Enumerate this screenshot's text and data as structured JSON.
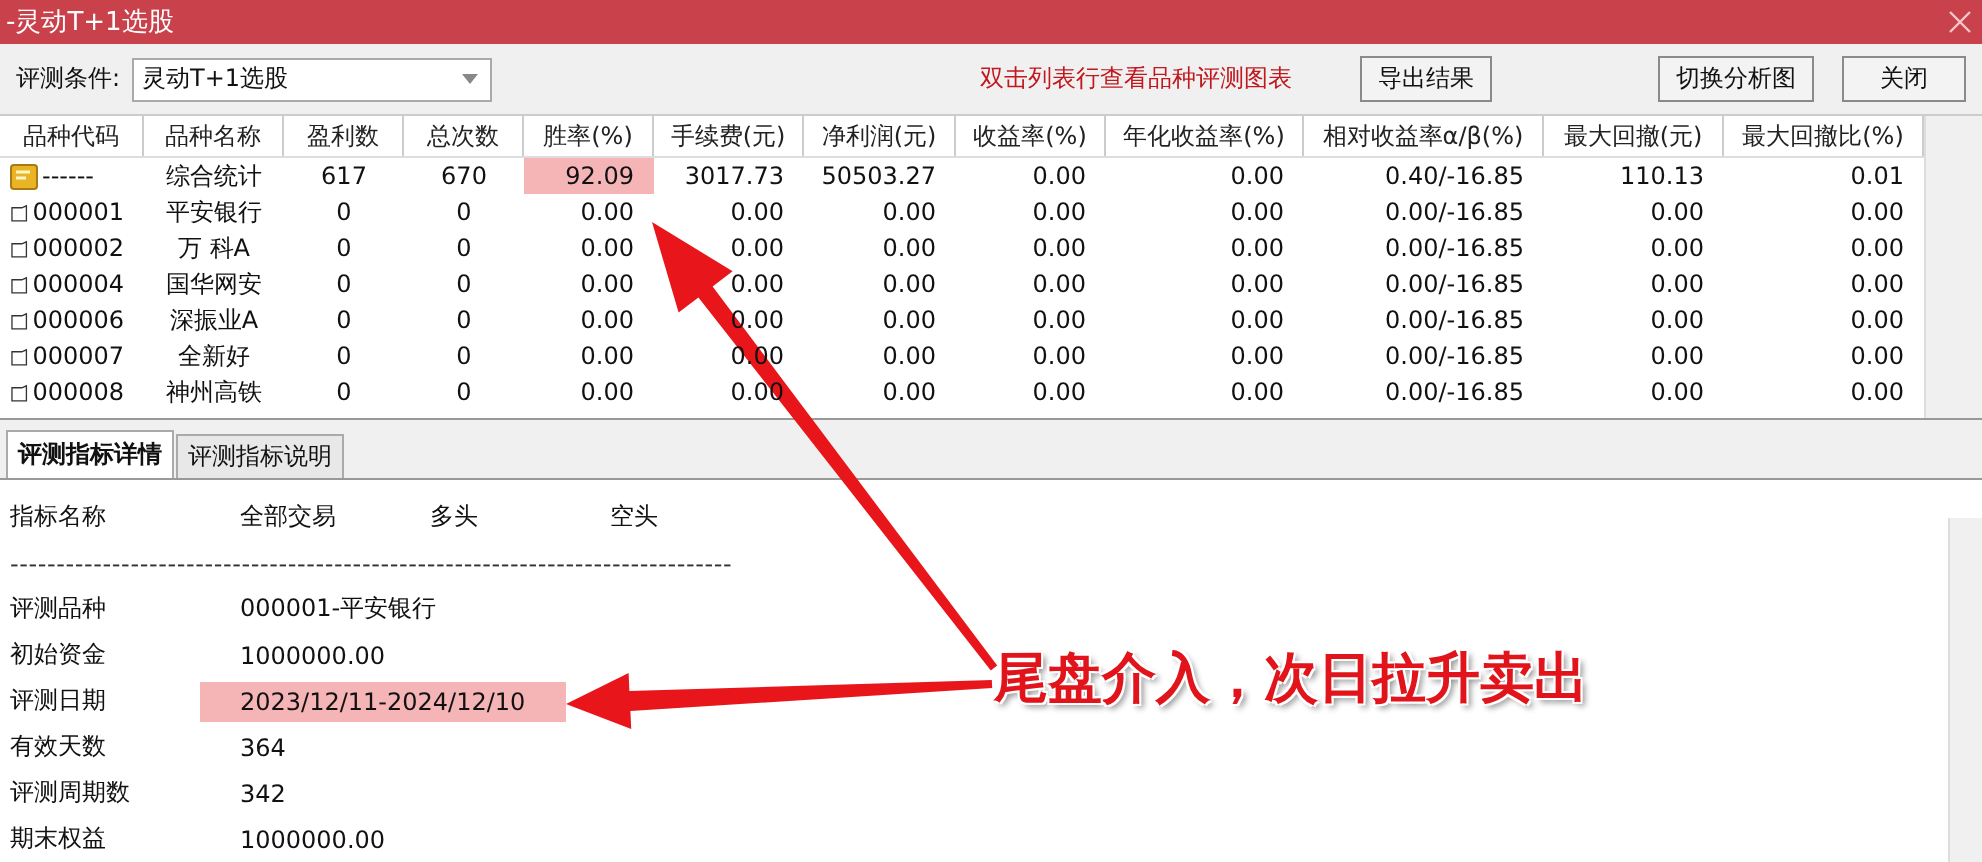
{
  "window": {
    "title": "-灵动T+1选股"
  },
  "toolbar": {
    "condition_label": "评测条件:",
    "condition_value": "灵动T+1选股",
    "hint": "双击列表行查看品种评测图表",
    "buttons": [
      {
        "label": "导出结果",
        "kind": "left"
      },
      {
        "label": "切换分析图",
        "kind": "right"
      },
      {
        "label": "关闭",
        "kind": "right"
      }
    ]
  },
  "table": {
    "columns": [
      "品种代码",
      "品种名称",
      "盈利数",
      "总次数",
      "胜率(%)",
      "手续费(元)",
      "净利润(元)",
      "收益率(%)",
      "年化收益率(%)",
      "相对收益率α/β(%)",
      "最大回撤(元)",
      "最大回撤比(%)"
    ],
    "rows": [
      {
        "kind": "summary",
        "cells": [
          "------",
          "综合统计",
          "617",
          "670",
          "92.09",
          "3017.73",
          "50503.27",
          "0.00",
          "0.00",
          "0.40/-16.85",
          "110.13",
          "0.01"
        ],
        "highlighted": [
          false,
          false,
          false,
          false,
          true,
          false,
          false,
          false,
          false,
          false,
          false,
          false
        ]
      },
      {
        "kind": "stock",
        "cells": [
          "000001",
          "平安银行",
          "0",
          "0",
          "0.00",
          "0.00",
          "0.00",
          "0.00",
          "0.00",
          "0.00/-16.85",
          "0.00",
          "0.00"
        ],
        "highlighted": [
          false,
          false,
          false,
          false,
          false,
          false,
          false,
          false,
          false,
          false,
          false,
          false
        ]
      },
      {
        "kind": "stock",
        "cells": [
          "000002",
          "万 科A",
          "0",
          "0",
          "0.00",
          "0.00",
          "0.00",
          "0.00",
          "0.00",
          "0.00/-16.85",
          "0.00",
          "0.00"
        ],
        "highlighted": [
          false,
          false,
          false,
          false,
          false,
          false,
          false,
          false,
          false,
          false,
          false,
          false
        ]
      },
      {
        "kind": "stock",
        "cells": [
          "000004",
          "国华网安",
          "0",
          "0",
          "0.00",
          "0.00",
          "0.00",
          "0.00",
          "0.00",
          "0.00/-16.85",
          "0.00",
          "0.00"
        ],
        "highlighted": [
          false,
          false,
          false,
          false,
          false,
          false,
          false,
          false,
          false,
          false,
          false,
          false
        ]
      },
      {
        "kind": "stock",
        "cells": [
          "000006",
          "深振业A",
          "0",
          "0",
          "0.00",
          "0.00",
          "0.00",
          "0.00",
          "0.00",
          "0.00/-16.85",
          "0.00",
          "0.00"
        ],
        "highlighted": [
          false,
          false,
          false,
          false,
          false,
          false,
          false,
          false,
          false,
          false,
          false,
          false
        ]
      },
      {
        "kind": "stock",
        "cells": [
          "000007",
          "全新好",
          "0",
          "0",
          "0.00",
          "0.00",
          "0.00",
          "0.00",
          "0.00",
          "0.00/-16.85",
          "0.00",
          "0.00"
        ],
        "highlighted": [
          false,
          false,
          false,
          false,
          false,
          false,
          false,
          false,
          false,
          false,
          false,
          false
        ]
      },
      {
        "kind": "stock",
        "cells": [
          "000008",
          "神州高铁",
          "0",
          "0",
          "0.00",
          "0.00",
          "0.00",
          "0.00",
          "0.00",
          "0.00/-16.85",
          "0.00",
          "0.00"
        ],
        "highlighted": [
          false,
          false,
          false,
          false,
          false,
          false,
          false,
          false,
          false,
          false,
          false,
          false
        ]
      }
    ]
  },
  "tabs": [
    {
      "label": "评测指标详情",
      "selected": true
    },
    {
      "label": "评测指标说明",
      "selected": false
    }
  ],
  "details": {
    "columns": [
      "指标名称",
      "全部交易",
      "多头",
      "空头"
    ],
    "separator": "------------------------------------------------------------------------------",
    "rows": [
      {
        "label": "评测品种",
        "value": "000001-平安银行",
        "highlighted": false
      },
      {
        "label": "初始资金",
        "value": "1000000.00",
        "highlighted": false
      },
      {
        "label": "评测日期",
        "value": "2023/12/11-2024/12/10",
        "highlighted": true
      },
      {
        "label": "有效天数",
        "value": "364",
        "highlighted": false
      },
      {
        "label": "评测周期数",
        "value": " 342",
        "highlighted": false
      },
      {
        "label": "期末权益",
        "value": "1000000.00",
        "highlighted": false
      }
    ]
  },
  "annotation": {
    "text": "尾盘介入，次日拉升卖出"
  }
}
